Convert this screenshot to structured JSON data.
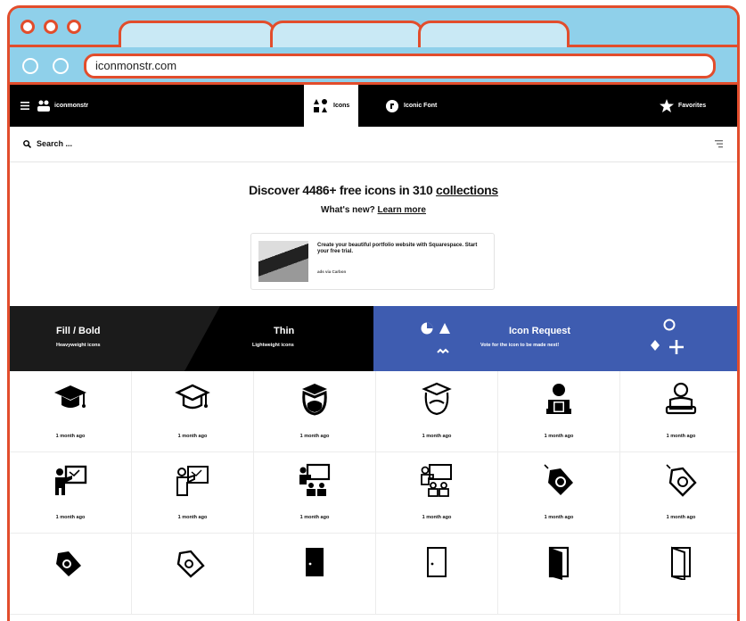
{
  "browser": {
    "url": "iconmonstr.com",
    "tabs": [
      "",
      "",
      ""
    ]
  },
  "nav": {
    "brand": "iconmonstr",
    "icons_tab": "Icons",
    "iconic_font_tab": "Iconic Font",
    "favorites": "Favorites"
  },
  "search": {
    "placeholder": "Search ..."
  },
  "hero": {
    "headline_prefix": "Discover 4486+ free icons in 310 ",
    "headline_link": "collections",
    "whatsnew_prefix": "What's new? ",
    "whatsnew_link": "Learn more"
  },
  "ad": {
    "text": "Create your beautiful portfolio website with Squarespace. Start your free trial.",
    "sub": "ads via Carbon"
  },
  "banners": {
    "fill_title": "Fill / Bold",
    "fill_sub": "Heavyweight icons",
    "thin_title": "Thin",
    "thin_sub": "Lightweight icons",
    "request_title": "Icon Request",
    "request_sub": "Vote for the icon to be made next!"
  },
  "grid": {
    "items": [
      {
        "icon": "graduation-cap-filled-icon",
        "age": "1 month ago"
      },
      {
        "icon": "graduation-cap-outline-icon",
        "age": "1 month ago"
      },
      {
        "icon": "student-filled-icon",
        "age": "1 month ago"
      },
      {
        "icon": "student-outline-icon",
        "age": "1 month ago"
      },
      {
        "icon": "reader-filled-icon",
        "age": "1 month ago"
      },
      {
        "icon": "reader-outline-icon",
        "age": "1 month ago"
      },
      {
        "icon": "teacher-board-filled-icon",
        "age": "1 month ago"
      },
      {
        "icon": "teacher-board-outline-icon",
        "age": "1 month ago"
      },
      {
        "icon": "classroom-filled-icon",
        "age": "1 month ago"
      },
      {
        "icon": "classroom-outline-icon",
        "age": "1 month ago"
      },
      {
        "icon": "price-tag-filled-icon",
        "age": "1 month ago"
      },
      {
        "icon": "price-tag-outline-icon",
        "age": "1 month ago"
      },
      {
        "icon": "price-tags-filled-icon",
        "age": ""
      },
      {
        "icon": "price-tags-outline-icon",
        "age": ""
      },
      {
        "icon": "door-closed-filled-icon",
        "age": ""
      },
      {
        "icon": "door-closed-outline-icon",
        "age": ""
      },
      {
        "icon": "door-open-filled-icon",
        "age": ""
      },
      {
        "icon": "door-open-outline-icon",
        "age": ""
      }
    ]
  },
  "colors": {
    "frame": "#e24d2c",
    "browser_chrome": "#8fd0ea",
    "request_banner": "#3e5cb0"
  }
}
